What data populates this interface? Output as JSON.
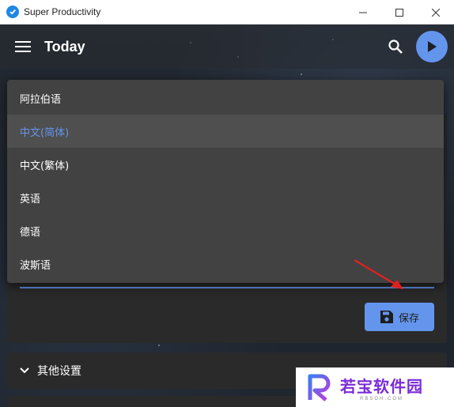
{
  "window": {
    "title": "Super Productivity",
    "controls": {
      "minimize": "minimize-icon",
      "maximize": "maximize-icon",
      "close": "close-icon"
    }
  },
  "toolbar": {
    "title": "Today",
    "icons": {
      "menu": "menu-icon",
      "search": "search-icon",
      "play": "play-icon"
    }
  },
  "language_dropdown": {
    "options": [
      {
        "label": "阿拉伯语",
        "selected": false
      },
      {
        "label": "中文(简体)",
        "selected": true
      },
      {
        "label": "中文(繁体)",
        "selected": false
      },
      {
        "label": "英语",
        "selected": false
      },
      {
        "label": "德语",
        "selected": false
      },
      {
        "label": "波斯语",
        "selected": false
      }
    ]
  },
  "form": {
    "save_label": "保存"
  },
  "sections": {
    "other_settings_label": "其他设置"
  },
  "watermark": {
    "main": "若宝软件园",
    "sub": "RBSOH.COM"
  },
  "colors": {
    "accent": "#6495ed",
    "panel": "#424242",
    "card": "#2a2a2a",
    "arrow": "#e02020"
  }
}
